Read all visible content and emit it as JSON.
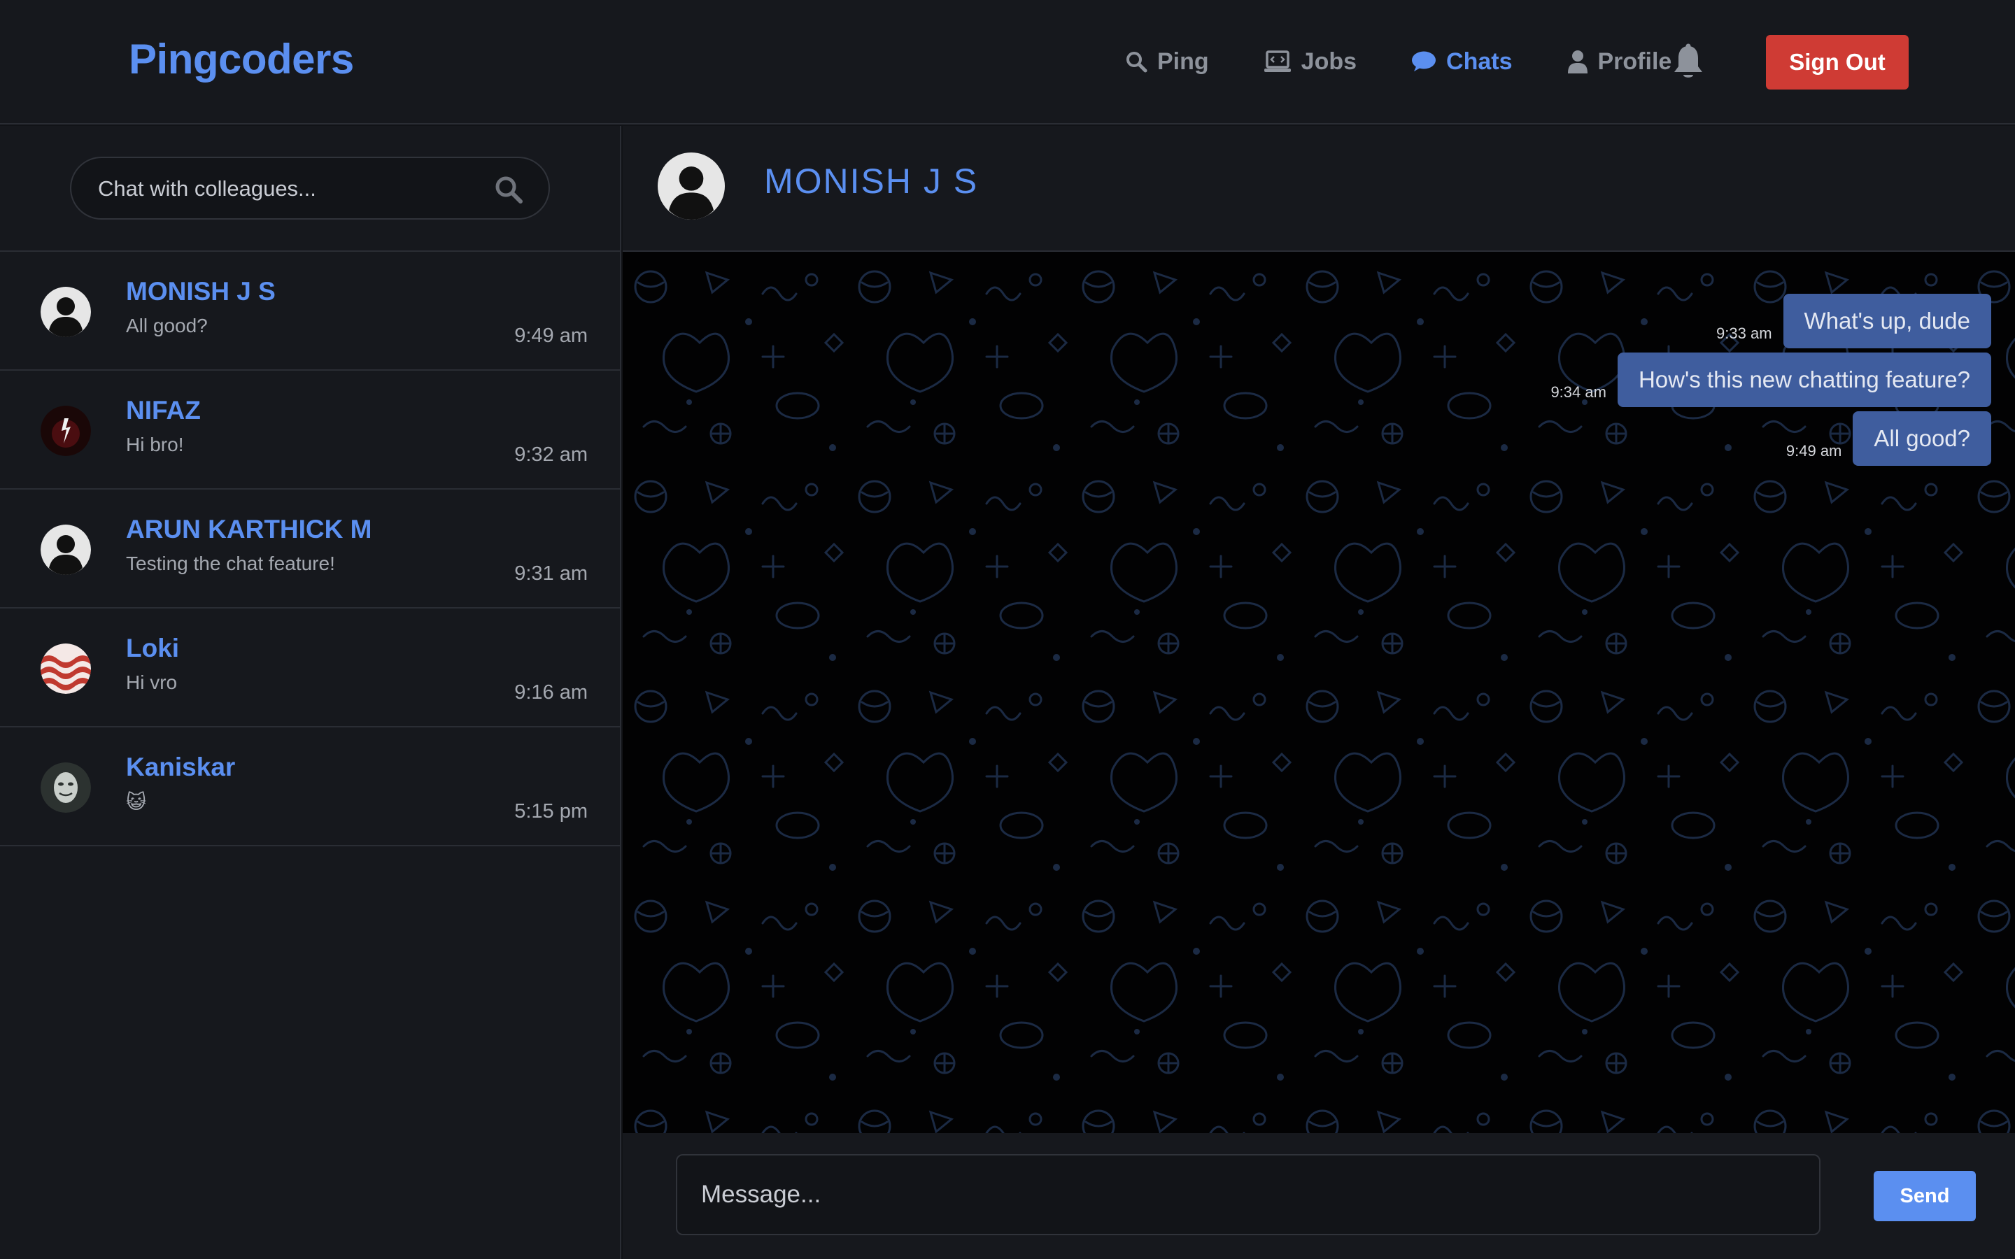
{
  "app": {
    "brand": "Pingcoders"
  },
  "nav": {
    "items": [
      {
        "label": "Ping",
        "icon": "search-icon",
        "active": false
      },
      {
        "label": "Jobs",
        "icon": "laptop-code-icon",
        "active": false
      },
      {
        "label": "Chats",
        "icon": "chat-bubble-icon",
        "active": true
      },
      {
        "label": "Profile",
        "icon": "user-icon",
        "active": false
      }
    ],
    "notifications_icon": "bell-icon",
    "signout_label": "Sign Out"
  },
  "sidebar": {
    "search_placeholder": "Chat with colleagues...",
    "conversations": [
      {
        "name": "MONISH J S",
        "preview": "All good?",
        "time": "9:49 am",
        "avatar": "default-avatar"
      },
      {
        "name": "NIFAZ",
        "preview": "Hi bro!",
        "time": "9:32 am",
        "avatar": "photo-avatar"
      },
      {
        "name": "ARUN KARTHICK M",
        "preview": "Testing the chat feature!",
        "time": "9:31 am",
        "avatar": "default-avatar"
      },
      {
        "name": "Loki",
        "preview": "Hi vro",
        "time": "9:16 am",
        "avatar": "wave-avatar"
      },
      {
        "name": "Kaniskar",
        "preview": "😺",
        "time": "5:15 pm",
        "avatar": "mask-avatar"
      }
    ]
  },
  "chat": {
    "contact_name": "MONISH J S",
    "messages": [
      {
        "text": "What's up, dude",
        "time": "9:33 am"
      },
      {
        "text": "How's this new chatting feature?",
        "time": "9:34 am"
      },
      {
        "text": "All good?",
        "time": "9:49 am"
      }
    ]
  },
  "composer": {
    "placeholder": "Message...",
    "send_label": "Send"
  },
  "colors": {
    "accent": "#5b8ff0",
    "signout": "#cf3b34",
    "bubble": "#3f5d9e",
    "background": "#16181d",
    "chat_background": "#020203"
  }
}
